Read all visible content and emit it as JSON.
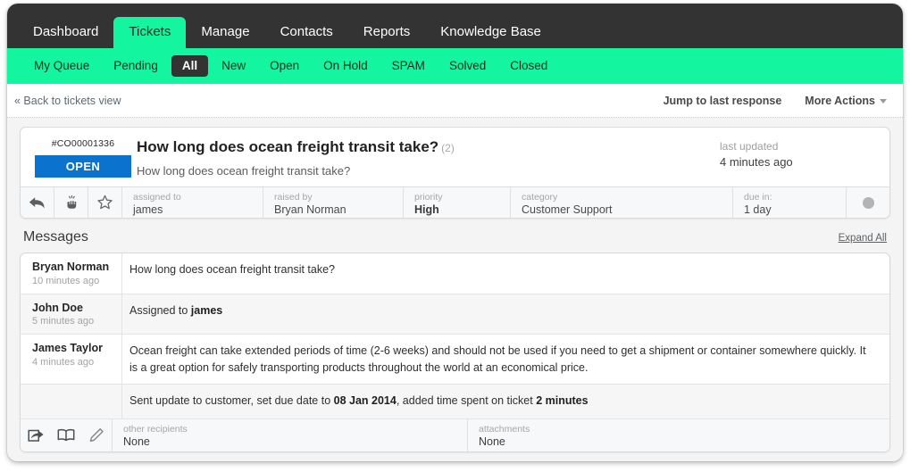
{
  "topnav": {
    "items": [
      {
        "label": "Dashboard",
        "active": false
      },
      {
        "label": "Tickets",
        "active": true
      },
      {
        "label": "Manage",
        "active": false
      },
      {
        "label": "Contacts",
        "active": false
      },
      {
        "label": "Reports",
        "active": false
      },
      {
        "label": "Knowledge Base",
        "active": false
      }
    ]
  },
  "subnav": {
    "items": [
      {
        "label": "My Queue",
        "active": false
      },
      {
        "label": "Pending",
        "active": false
      },
      {
        "label": "All",
        "active": true
      },
      {
        "label": "New",
        "active": false
      },
      {
        "label": "Open",
        "active": false
      },
      {
        "label": "On Hold",
        "active": false
      },
      {
        "label": "SPAM",
        "active": false
      },
      {
        "label": "Solved",
        "active": false
      },
      {
        "label": "Closed",
        "active": false
      }
    ]
  },
  "actionbar": {
    "back_label": "« Back to tickets view",
    "jump_label": "Jump to last response",
    "more_actions_label": "More Actions"
  },
  "ticket": {
    "id": "#CO00001336",
    "status": "OPEN",
    "title": "How long does ocean freight transit take?",
    "message_count": "(2)",
    "subtitle": "How long does ocean freight transit take?",
    "last_updated_label": "last updated",
    "last_updated_value": "4 minutes ago",
    "meta": {
      "assigned_to_label": "assigned to",
      "assigned_to_value": "james",
      "raised_by_label": "raised by",
      "raised_by_value": "Bryan Norman",
      "priority_label": "priority",
      "priority_value": "High",
      "category_label": "category",
      "category_value": "Customer Support",
      "due_in_label": "due in:",
      "due_in_value": "1 day"
    }
  },
  "messages": {
    "title": "Messages",
    "expand_all_label": "Expand All",
    "rows": [
      {
        "author": "Bryan Norman",
        "time": "10 minutes ago",
        "body_pre": "How long does ocean freight transit take?",
        "body_bold": "",
        "body_post": ""
      },
      {
        "author": "John Doe",
        "time": "5 minutes ago",
        "body_pre": "Assigned to ",
        "body_bold": "james",
        "body_post": ""
      },
      {
        "author": "James Taylor",
        "time": "4 minutes ago",
        "body_pre": "Ocean freight can take extended periods of time (2-6 weeks) and should not be used if you need to get a shipment or container somewhere quickly. It is a great option for safely transporting products throughout the world at an economical price.",
        "body_bold": "",
        "body_post": ""
      }
    ],
    "note": {
      "pre": "Sent update to customer, set due date to ",
      "bold1": "08 Jan 2014",
      "mid": ", added time spent on ticket ",
      "bold2": "2 minutes"
    }
  },
  "bottom": {
    "other_recipients_label": "other recipients",
    "other_recipients_value": "None",
    "attachments_label": "attachments",
    "attachments_value": "None"
  },
  "colors": {
    "accent_green": "#14f5a0",
    "dark_nav": "#333333",
    "status_blue": "#0b72ce",
    "page_bg": "#f4f4f4"
  }
}
